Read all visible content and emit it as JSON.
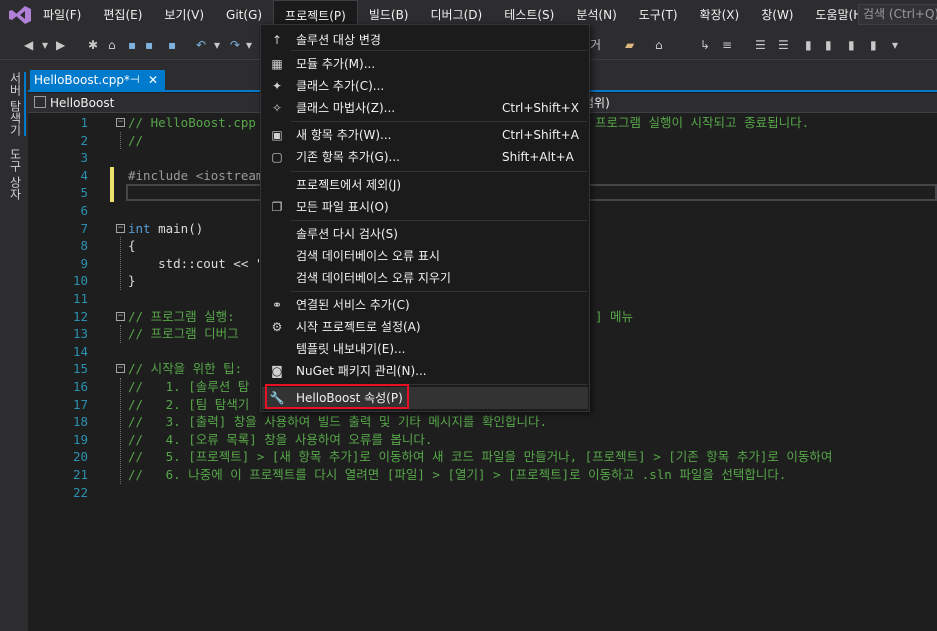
{
  "menubar": {
    "items": [
      "파일(F)",
      "편집(E)",
      "보기(V)",
      "Git(G)",
      "프로젝트(P)",
      "빌드(B)",
      "디버그(D)",
      "테스트(S)",
      "분석(N)",
      "도구(T)",
      "확장(X)",
      "창(W)",
      "도움말(H)"
    ],
    "search_placeholder": "검색 (Ctrl+Q)"
  },
  "sidebar": {
    "server_explorer": "서버 탐색기",
    "toolbox": "도구 상자"
  },
  "tab": {
    "label": "HelloBoost.cpp*",
    "pin": "⊣",
    "close": "✕"
  },
  "navbar": {
    "project": "HelloBoost",
    "scope": "범위)"
  },
  "toolbar": {
    "fragment": "거"
  },
  "code_lines": [
    {
      "n": "1",
      "text": "// HelloBoost.cpp"
    },
    {
      "n": "2",
      "text": "//"
    },
    {
      "n": "3",
      "text": ""
    },
    {
      "n": "4",
      "text": "#include <iostream>"
    },
    {
      "n": "5",
      "text": ""
    },
    {
      "n": "6",
      "text": ""
    },
    {
      "n": "7",
      "text": "int main()"
    },
    {
      "n": "8",
      "text": "{"
    },
    {
      "n": "9",
      "text": "    std::cout << \"H"
    },
    {
      "n": "10",
      "text": "}"
    },
    {
      "n": "11",
      "text": ""
    },
    {
      "n": "12",
      "text": "// 프로그램 실행: "
    },
    {
      "n": "13",
      "text": "// 프로그램 디버그"
    },
    {
      "n": "14",
      "text": ""
    },
    {
      "n": "15",
      "text": "// 시작을 위한 팁: "
    },
    {
      "n": "16",
      "text": "//   1. [솔루션 탐"
    },
    {
      "n": "17",
      "text": "//   2. [팀 탐색기"
    },
    {
      "n": "18",
      "text": "//   3. [출력] 창을 사용하여 빌드 출력 및 기타 메시지를 확인합니다."
    },
    {
      "n": "19",
      "text": "//   4. [오류 목록] 창을 사용하여 오류를 봅니다."
    },
    {
      "n": "20",
      "text": "//   5. [프로젝트] > [새 항목 추가]로 이동하여 새 코드 파일을 만들거나, [프로젝트] > [기존 항목 추가]로 이동하여"
    },
    {
      "n": "21",
      "text": "//   6. 나중에 이 프로젝트를 다시 열려면 [파일] > [열기] > [프로젝트]로 이동하고 .sln 파일을 선택합니다."
    },
    {
      "n": "22",
      "text": ""
    }
  ],
  "line1_tail": "프로그램 실행이 시작되고 종료됩니다.",
  "line12_tail": "] 메뉴",
  "dropdown": {
    "items": [
      {
        "icon": "↑",
        "label": "솔루션 대상 변경",
        "shortcut": ""
      },
      {
        "icon": "▦",
        "label": "모듈 추가(M)...",
        "shortcut": ""
      },
      {
        "icon": "✦",
        "label": "클래스 추가(C)...",
        "shortcut": ""
      },
      {
        "icon": "✧",
        "label": "클래스 마법사(Z)...",
        "shortcut": "Ctrl+Shift+X"
      },
      {
        "icon": "▣",
        "label": "새 항목 추가(W)...",
        "shortcut": "Ctrl+Shift+A"
      },
      {
        "icon": "▢",
        "label": "기존 항목 추가(G)...",
        "shortcut": "Shift+Alt+A"
      },
      {
        "icon": "",
        "label": "프로젝트에서 제외(J)",
        "shortcut": ""
      },
      {
        "icon": "❐",
        "label": "모든 파일 표시(O)",
        "shortcut": ""
      },
      {
        "icon": "",
        "label": "솔루션 다시 검사(S)",
        "shortcut": ""
      },
      {
        "icon": "",
        "label": "검색 데이터베이스 오류 표시",
        "shortcut": ""
      },
      {
        "icon": "",
        "label": "검색 데이터베이스 오류 지우기",
        "shortcut": ""
      },
      {
        "icon": "⚭",
        "label": "연결된 서비스 추가(C)",
        "shortcut": ""
      },
      {
        "icon": "⚙",
        "label": "시작 프로젝트로 설정(A)",
        "shortcut": ""
      },
      {
        "icon": "",
        "label": "템플릿 내보내기(E)...",
        "shortcut": ""
      },
      {
        "icon": "◙",
        "label": "NuGet 패키지 관리(N)...",
        "shortcut": ""
      },
      {
        "icon": "🔧",
        "label": "HelloBoost 속성(P)",
        "shortcut": ""
      }
    ]
  },
  "colors": {
    "accent": "#007acc",
    "highlight": "#e81123",
    "comment": "#57a64a",
    "keyword": "#569cd6",
    "line_number": "#2b91af"
  }
}
